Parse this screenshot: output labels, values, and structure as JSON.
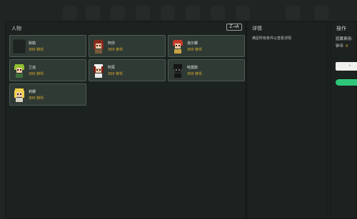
{
  "panels": {
    "characters": {
      "title": "人物",
      "sort_label": "Z→A",
      "cards": [
        {
          "name": "默勒",
          "price": "300 钟币",
          "avatar": "empty"
        },
        {
          "name": "阿莎",
          "price": "300 钟币",
          "avatar": "red-hair-girl"
        },
        {
          "name": "洛尔娜",
          "price": "300 钟币",
          "avatar": "red-hair-boy"
        },
        {
          "name": "兰迪",
          "price": "300 钟币",
          "avatar": "green-hair-boy"
        },
        {
          "name": "阿芙",
          "price": "300 钟币",
          "avatar": "dark-hair-white-cap"
        },
        {
          "name": "哈莫斯",
          "price": "300 钟币",
          "avatar": "shadow-figure"
        },
        {
          "name": "莉娜",
          "price": "300 钟币",
          "avatar": "blonde-girl"
        }
      ]
    },
    "detail": {
      "title": "详情",
      "hint": "满足所有条件以查看详情"
    },
    "operations": {
      "title": "操作",
      "recruit_cost_label": "招募费用:",
      "coins_label": "钟币",
      "coins_value": "0",
      "button_label": "-"
    }
  },
  "colors": {
    "price": "#e0b32a",
    "accent_green": "#2ec77a",
    "card_bg": "#303a35"
  }
}
